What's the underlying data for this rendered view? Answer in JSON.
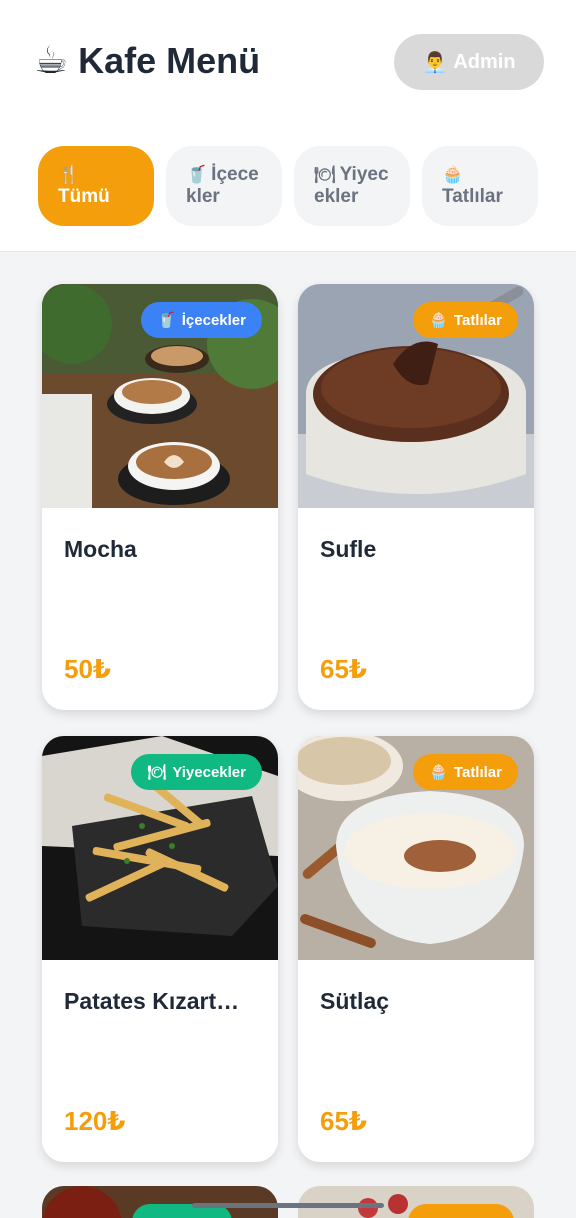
{
  "app": {
    "title": "Kafe Menü",
    "title_icon": "coffee-cup-icon",
    "admin_label": "Admin",
    "admin_icon": "office-worker-icon"
  },
  "tabs": [
    {
      "label": "Tümü",
      "icon": "fork-knife-icon",
      "active": true
    },
    {
      "label": "İçecekler",
      "icon": "cup-straw-icon",
      "active": false
    },
    {
      "label": "Yiyecekler",
      "icon": "plate-icon",
      "active": false
    },
    {
      "label": "Tatlılar",
      "icon": "cupcake-icon",
      "active": false
    }
  ],
  "items": [
    {
      "name": "Mocha",
      "price": "50₺",
      "category": "İçecekler",
      "badge_color": "#3b82f6"
    },
    {
      "name": "Sufle",
      "price": "65₺",
      "category": "Tatlılar",
      "badge_color": "#f59e0b"
    },
    {
      "name": "Patates Kızart…",
      "price": "120₺",
      "category": "Yiyecekler",
      "badge_color": "#10b981"
    },
    {
      "name": "Sütlaç",
      "price": "65₺",
      "category": "Tatlılar",
      "badge_color": "#f59e0b"
    }
  ],
  "colors": {
    "accent": "#f59e0b",
    "drinks": "#3b82f6",
    "foods": "#10b981",
    "text": "#1f2937"
  }
}
